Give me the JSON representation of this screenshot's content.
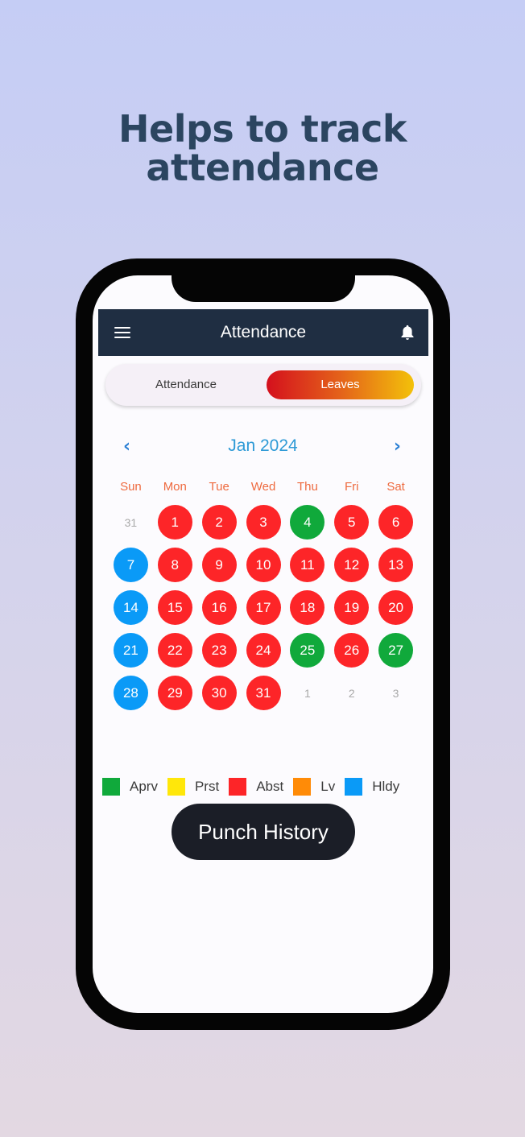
{
  "headline": {
    "line1": "Helps to track",
    "line2": "attendance"
  },
  "appbar": {
    "title": "Attendance",
    "menu_icon": "hamburger-menu-icon",
    "bell_icon": "bell-icon"
  },
  "toggle": {
    "options": [
      "Attendance",
      "Leaves"
    ],
    "selected": "Leaves"
  },
  "calendar": {
    "month_label": "Jan 2024",
    "prev_icon": "chevron-left-icon",
    "next_icon": "chevron-right-icon",
    "weekdays": [
      "Sun",
      "Mon",
      "Tue",
      "Wed",
      "Thu",
      "Fri",
      "Sat"
    ],
    "weeks": [
      [
        {
          "d": "31",
          "s": "none"
        },
        {
          "d": "1",
          "s": "abst"
        },
        {
          "d": "2",
          "s": "abst"
        },
        {
          "d": "3",
          "s": "abst"
        },
        {
          "d": "4",
          "s": "aprv"
        },
        {
          "d": "5",
          "s": "abst"
        },
        {
          "d": "6",
          "s": "abst"
        }
      ],
      [
        {
          "d": "7",
          "s": "hldy"
        },
        {
          "d": "8",
          "s": "abst"
        },
        {
          "d": "9",
          "s": "abst"
        },
        {
          "d": "10",
          "s": "abst"
        },
        {
          "d": "11",
          "s": "abst"
        },
        {
          "d": "12",
          "s": "abst"
        },
        {
          "d": "13",
          "s": "abst"
        }
      ],
      [
        {
          "d": "14",
          "s": "hldy"
        },
        {
          "d": "15",
          "s": "abst"
        },
        {
          "d": "16",
          "s": "abst"
        },
        {
          "d": "17",
          "s": "abst"
        },
        {
          "d": "18",
          "s": "abst"
        },
        {
          "d": "19",
          "s": "abst"
        },
        {
          "d": "20",
          "s": "abst"
        }
      ],
      [
        {
          "d": "21",
          "s": "hldy"
        },
        {
          "d": "22",
          "s": "abst"
        },
        {
          "d": "23",
          "s": "abst"
        },
        {
          "d": "24",
          "s": "abst"
        },
        {
          "d": "25",
          "s": "aprv"
        },
        {
          "d": "26",
          "s": "abst"
        },
        {
          "d": "27",
          "s": "aprv"
        }
      ],
      [
        {
          "d": "28",
          "s": "hldy"
        },
        {
          "d": "29",
          "s": "abst"
        },
        {
          "d": "30",
          "s": "abst"
        },
        {
          "d": "31",
          "s": "abst"
        },
        {
          "d": "1",
          "s": "none"
        },
        {
          "d": "2",
          "s": "none"
        },
        {
          "d": "3",
          "s": "none"
        }
      ]
    ]
  },
  "legend": [
    {
      "key": "aprv",
      "label": "Aprv",
      "color": "#10a93b"
    },
    {
      "key": "prst",
      "label": "Prst",
      "color": "#ffe70a"
    },
    {
      "key": "abst",
      "label": "Abst",
      "color": "#fd2528"
    },
    {
      "key": "lv",
      "label": "Lv",
      "color": "#ff8b07"
    },
    {
      "key": "hldy",
      "label": "Hldy",
      "color": "#0a9af7"
    }
  ],
  "punch_button": {
    "label": "Punch History"
  }
}
